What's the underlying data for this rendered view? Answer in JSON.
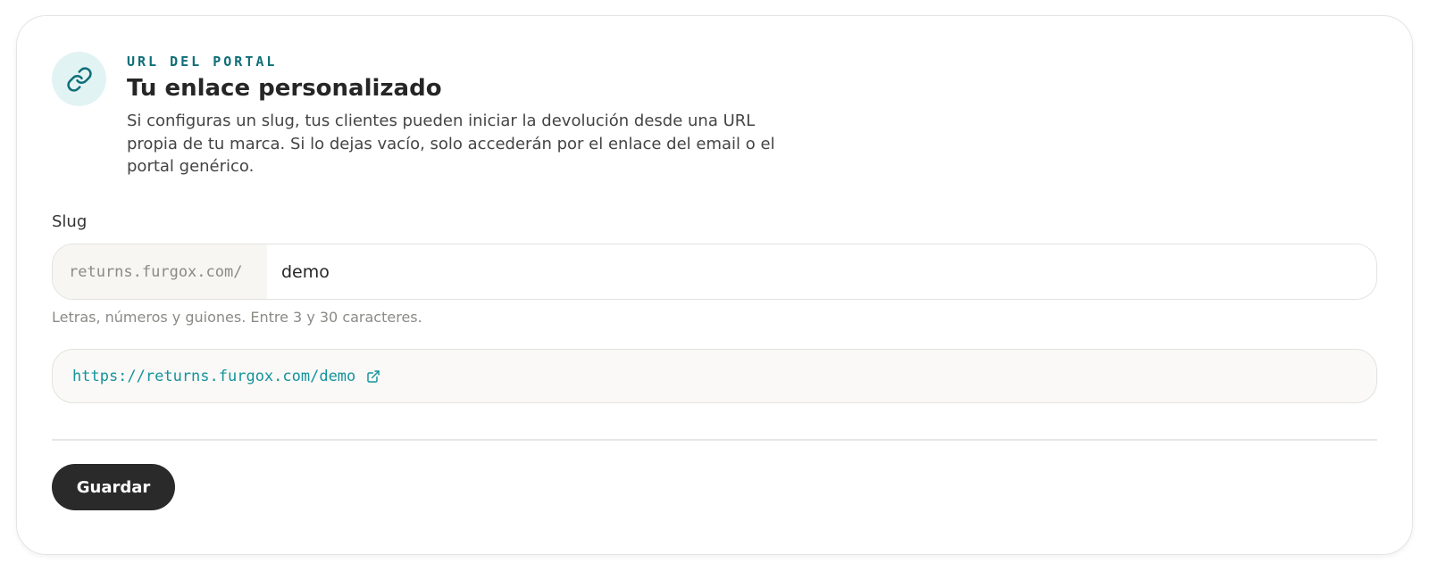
{
  "header": {
    "icon": "link-icon",
    "eyebrow": "URL DEL PORTAL",
    "title": "Tu enlace personalizado",
    "description": "Si configuras un slug, tus clientes pueden iniciar la devolución desde una URL propia de tu marca. Si lo dejas vacío, solo accederán por el enlace del email o el portal genérico."
  },
  "slug_field": {
    "label": "Slug",
    "prefix": "returns.furgox.com/",
    "value": "demo",
    "hint": "Letras, números y guiones. Entre 3 y 30 caracteres."
  },
  "preview": {
    "url": "https://returns.furgox.com/demo",
    "icon": "external-link-icon"
  },
  "actions": {
    "save_label": "Guardar"
  },
  "colors": {
    "accent": "#0f6e77",
    "link": "#14939c",
    "icon_bg": "#e2f3f4",
    "button_bg": "#2a2a2a"
  }
}
